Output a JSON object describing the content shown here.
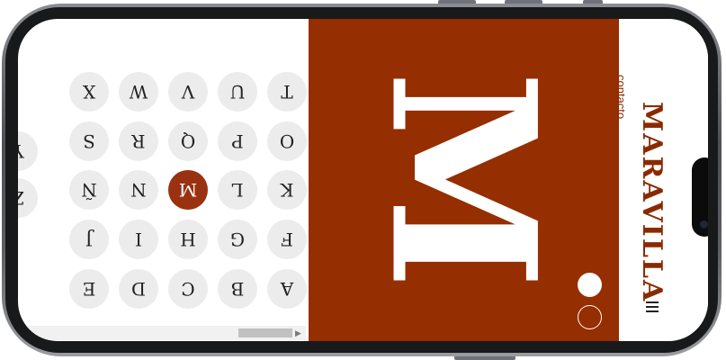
{
  "letters_grid": {
    "rows": [
      [
        "A",
        "B",
        "C",
        "D",
        "E"
      ],
      [
        "F",
        "G",
        "H",
        "I",
        "J"
      ],
      [
        "K",
        "L",
        "M",
        "N",
        "Ñ"
      ],
      [
        "O",
        "P",
        "Q",
        "R",
        "S"
      ],
      [
        "T",
        "U",
        "V",
        "W",
        "X"
      ]
    ],
    "partial_column": [
      "Y",
      "Z"
    ],
    "selected": "M"
  },
  "display": {
    "letter": "M"
  },
  "nav": {
    "contact_label": "contacto",
    "brand": "MARAVILLA"
  },
  "colors": {
    "accent": "#952e00",
    "brand_text": "#8a2a00",
    "circle_bg": "#ececec"
  },
  "icons": [
    "menu-icon",
    "slide-dot-filled-icon",
    "slide-dot-outline-icon"
  ]
}
